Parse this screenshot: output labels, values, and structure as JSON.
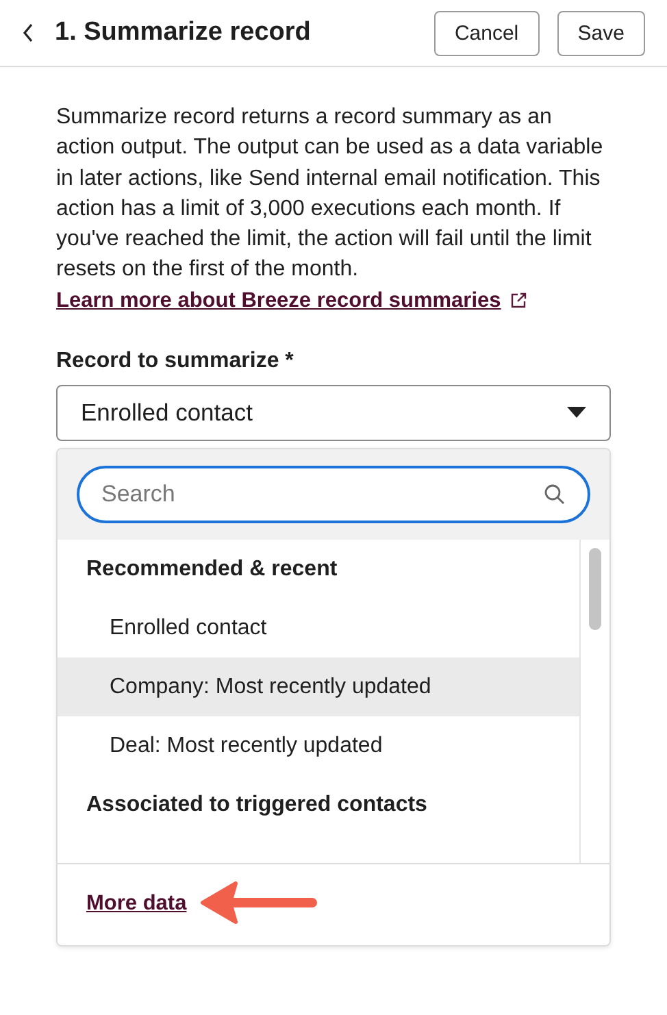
{
  "header": {
    "title": "1. Summarize record",
    "buttons": [
      "Cancel",
      "Save"
    ]
  },
  "description": "Summarize record returns a record summary as an action output. The output can be used as a data variable in later actions, like Send internal email notification. This action has a limit of 3,000 executions each month. If you've reached the limit, the action will fail until the limit resets on the first of the month.",
  "learn_more_link": "Learn more about Breeze record summaries",
  "record_field": {
    "label": "Record to summarize *",
    "value": "Enrolled contact",
    "expanded": true
  },
  "dropdown": {
    "search": {
      "placeholder": "Search"
    },
    "items": [
      {
        "kind": "group",
        "label": "Recommended & recent"
      },
      {
        "kind": "option",
        "label": "Enrolled contact",
        "selected": false
      },
      {
        "kind": "option",
        "label": "Company: Most recently updated",
        "selected": true
      },
      {
        "kind": "option",
        "label": "Deal: Most recently updated",
        "selected": false
      },
      {
        "kind": "group",
        "label": "Associated to triggered contacts"
      }
    ],
    "footer_link": "More data"
  }
}
